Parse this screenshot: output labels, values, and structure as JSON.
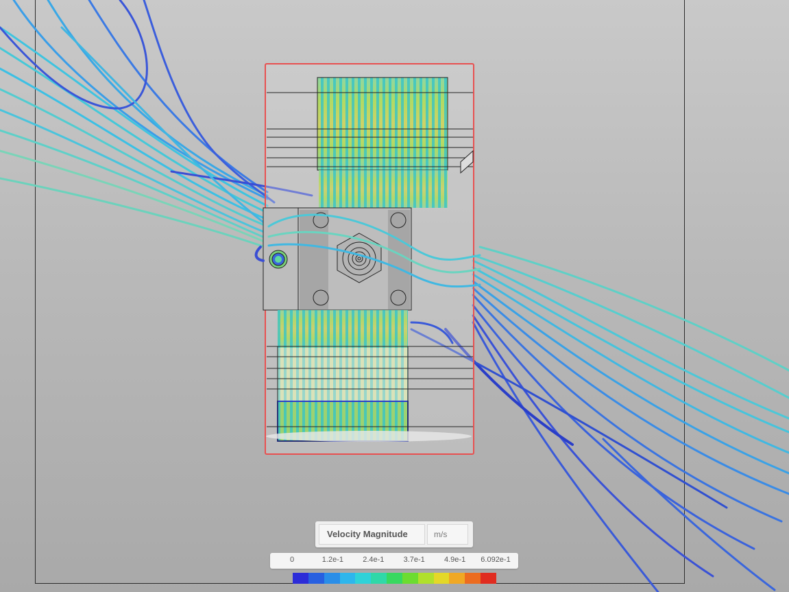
{
  "legend": {
    "title": "Velocity Magnitude",
    "unit": "m/s",
    "ticks": [
      "0",
      "1.2e-1",
      "2.4e-1",
      "3.7e-1",
      "4.9e-1",
      "6.092e-1"
    ],
    "min": 0,
    "max": 0.6092,
    "colors": [
      "#2c2cd8",
      "#2860e0",
      "#2a8ee8",
      "#2eb6ec",
      "#30d2d8",
      "#30d8a8",
      "#38d860",
      "#6cdc30",
      "#b0e02c",
      "#e4d828",
      "#f0a824",
      "#ec6c20",
      "#e02c20"
    ]
  },
  "scene": {
    "selection_color": "#e85050",
    "background_color": "#bdbdbd"
  }
}
